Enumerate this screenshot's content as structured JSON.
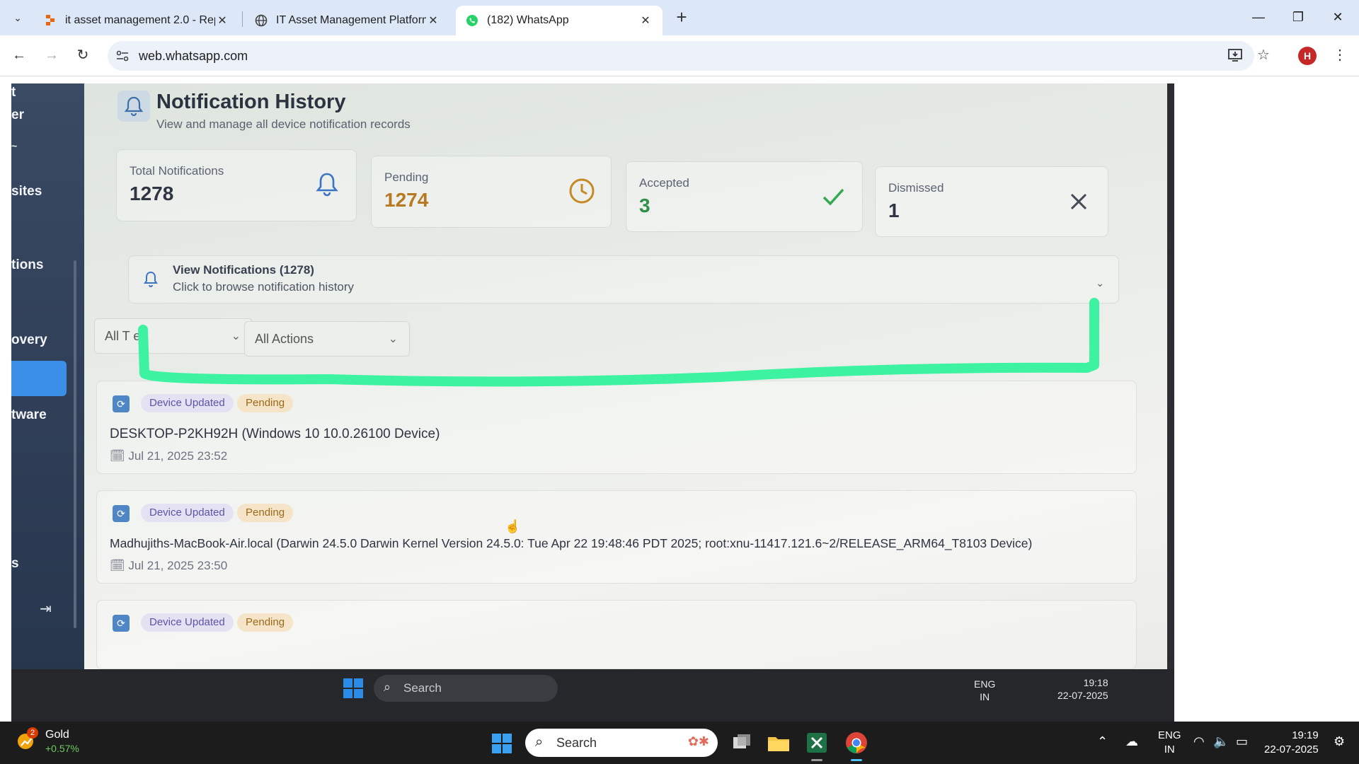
{
  "browser": {
    "tabs": [
      {
        "title": "it asset management 2.0 - Repli",
        "active": false
      },
      {
        "title": "IT Asset Management Platform",
        "active": false
      },
      {
        "title": "(182) WhatsApp",
        "active": true
      }
    ],
    "url": "web.whatsapp.com",
    "profile_initial": "H"
  },
  "sidebar": {
    "items": [
      "t",
      "er",
      "sites",
      "tions",
      "overy",
      "tware",
      "s"
    ]
  },
  "page": {
    "title": "Notification History",
    "subtitle": "View and manage all device notification records"
  },
  "stats": [
    {
      "label": "Total Notifications",
      "value": "1278",
      "icon": "bell-icon",
      "color": "#2f3542"
    },
    {
      "label": "Pending",
      "value": "1274",
      "icon": "clock-icon",
      "color": "#b7791f"
    },
    {
      "label": "Accepted",
      "value": "3",
      "icon": "check-icon",
      "color": "#2f8f46"
    },
    {
      "label": "Dismissed",
      "value": "1",
      "icon": "close-icon",
      "color": "#2f3542"
    }
  ],
  "collapse": {
    "title": "View Notifications (1278)",
    "subtitle": "Click to browse notification history"
  },
  "filters": {
    "type_value": "All T   es",
    "action_value": "All Actions"
  },
  "notifications": [
    {
      "badge_type": "Device Updated",
      "badge_status": "Pending",
      "title": "DESKTOP-P2KH92H (Windows 10 10.0.26100 Device)",
      "date": "Jul 21, 2025 23:52"
    },
    {
      "badge_type": "Device Updated",
      "badge_status": "Pending",
      "title": "Madhujiths-MacBook-Air.local (Darwin 24.5.0 Darwin Kernel Version 24.5.0: Tue Apr 22 19:48:46 PDT 2025; root:xnu-11417.121.6~2/RELEASE_ARM64_T8103 Device)",
      "date": "Jul 21, 2025 23:50"
    },
    {
      "badge_type": "Device Updated",
      "badge_status": "Pending",
      "title": "",
      "date": ""
    }
  ],
  "inner_taskbar": {
    "search": "Search",
    "lang_1": "ENG",
    "lang_2": "IN",
    "time": "19:18",
    "date": "22-07-2025"
  },
  "taskbar": {
    "weather_name": "Gold",
    "weather_change": "+0.57%",
    "weather_badge": "2",
    "search": "Search",
    "lang_1": "ENG",
    "lang_2": "IN",
    "time": "19:19",
    "date": "22-07-2025"
  },
  "colors": {
    "highlight": "#3df2a0",
    "accent_blue": "#3b8fe6"
  }
}
